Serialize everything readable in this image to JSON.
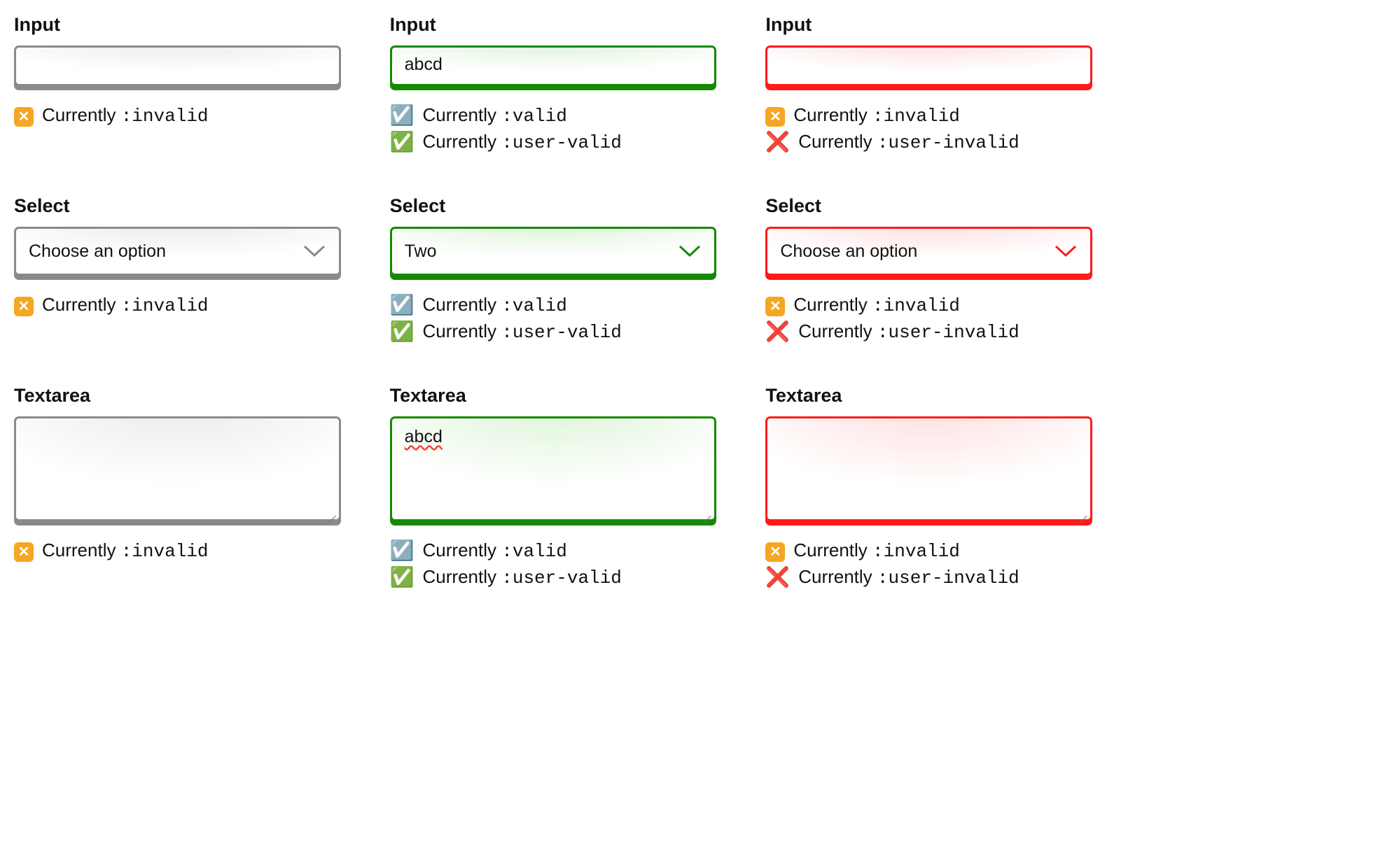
{
  "labels": {
    "input": "Input",
    "select": "Select",
    "textarea": "Textarea"
  },
  "values": {
    "input_valid": "abcd",
    "select_neutral": "Choose an option",
    "select_valid": "Two",
    "select_invalid": "Choose an option",
    "textarea_valid": "abcd"
  },
  "status": {
    "currently_prefix": "Currently ",
    "pseudo_invalid": ":invalid",
    "pseudo_valid": ":valid",
    "pseudo_user_valid": ":user-valid",
    "pseudo_user_invalid": ":user-invalid"
  },
  "emoji": {
    "x_orange": "❎",
    "x_red": "❌",
    "check_blue": "☑️",
    "check_green": "✅"
  },
  "colors": {
    "neutral": "#8a8a8a",
    "valid": "#138a00",
    "invalid": "#ff1a1a"
  }
}
